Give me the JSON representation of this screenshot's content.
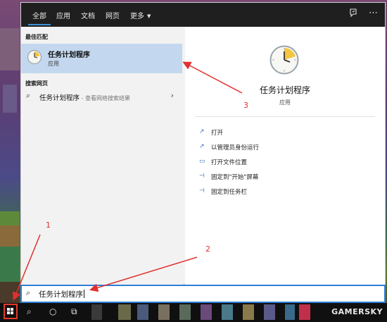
{
  "tabs": [
    {
      "label": "全部"
    },
    {
      "label": "应用"
    },
    {
      "label": "文档"
    },
    {
      "label": "网页"
    },
    {
      "label": "更多"
    }
  ],
  "top_icons": [
    "feedback-icon",
    "more-options-icon"
  ],
  "sections": {
    "best_match_label": "最佳匹配",
    "web_label": "搜索网页"
  },
  "best_match": {
    "name": "任务计划程序",
    "type": "应用"
  },
  "web_result": {
    "query": "任务计划程序",
    "hint": " - 查看网络搜索结果"
  },
  "detail": {
    "name": "任务计划程序",
    "type": "应用"
  },
  "actions": [
    {
      "label": "打开",
      "icon": "open-icon"
    },
    {
      "label": "以管理员身份运行",
      "icon": "run-as-admin-icon"
    },
    {
      "label": "打开文件位置",
      "icon": "file-location-icon"
    },
    {
      "label": "固定到\"开始\"屏幕",
      "icon": "pin-start-icon"
    },
    {
      "label": "固定到任务栏",
      "icon": "pin-taskbar-icon"
    }
  ],
  "search": {
    "value": "任务计划程序"
  },
  "annotations": {
    "n1": "1",
    "n2": "2",
    "n3": "3"
  },
  "watermark": "GAMERSKY",
  "colors": {
    "accent": "#2f7fd6",
    "annotation": "#e03030",
    "selection": "#c3d8ef"
  }
}
